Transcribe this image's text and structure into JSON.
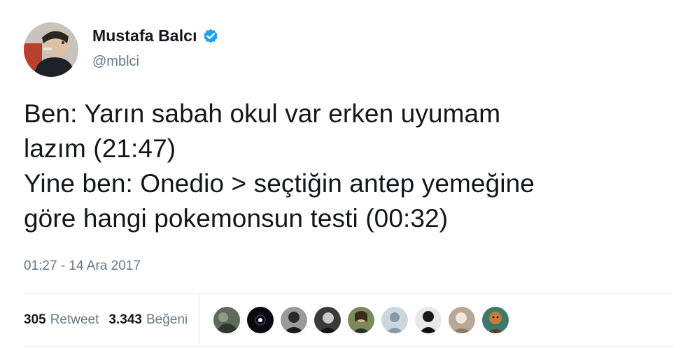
{
  "tweet": {
    "author": {
      "display_name": "Mustafa Balcı",
      "handle": "@mblci",
      "verified": true,
      "avatar_icon": "user-avatar-photo"
    },
    "text_lines": [
      "Ben: Yarın sabah okul var erken uyumam",
      "lazım (21:47)",
      "Yine ben: Onedio > seçtiğin antep yemeğine",
      "göre hangi pokemonsun testi (00:32)"
    ],
    "timestamp": "01:27 - 14 Ara 2017",
    "stats": {
      "retweets": {
        "count": "305",
        "label": "Retweet"
      },
      "likes": {
        "count": "3.343",
        "label": "Beğeni"
      }
    },
    "likers": [
      "liker-avatar-1",
      "liker-avatar-2",
      "liker-avatar-3",
      "liker-avatar-4",
      "liker-avatar-5",
      "default-egg-avatar",
      "liker-avatar-7",
      "liker-avatar-8",
      "liker-avatar-9"
    ]
  },
  "colors": {
    "text_primary": "#14171a",
    "text_secondary": "#657786",
    "verified_blue": "#1da1f2",
    "divider": "#e6ecf0"
  }
}
